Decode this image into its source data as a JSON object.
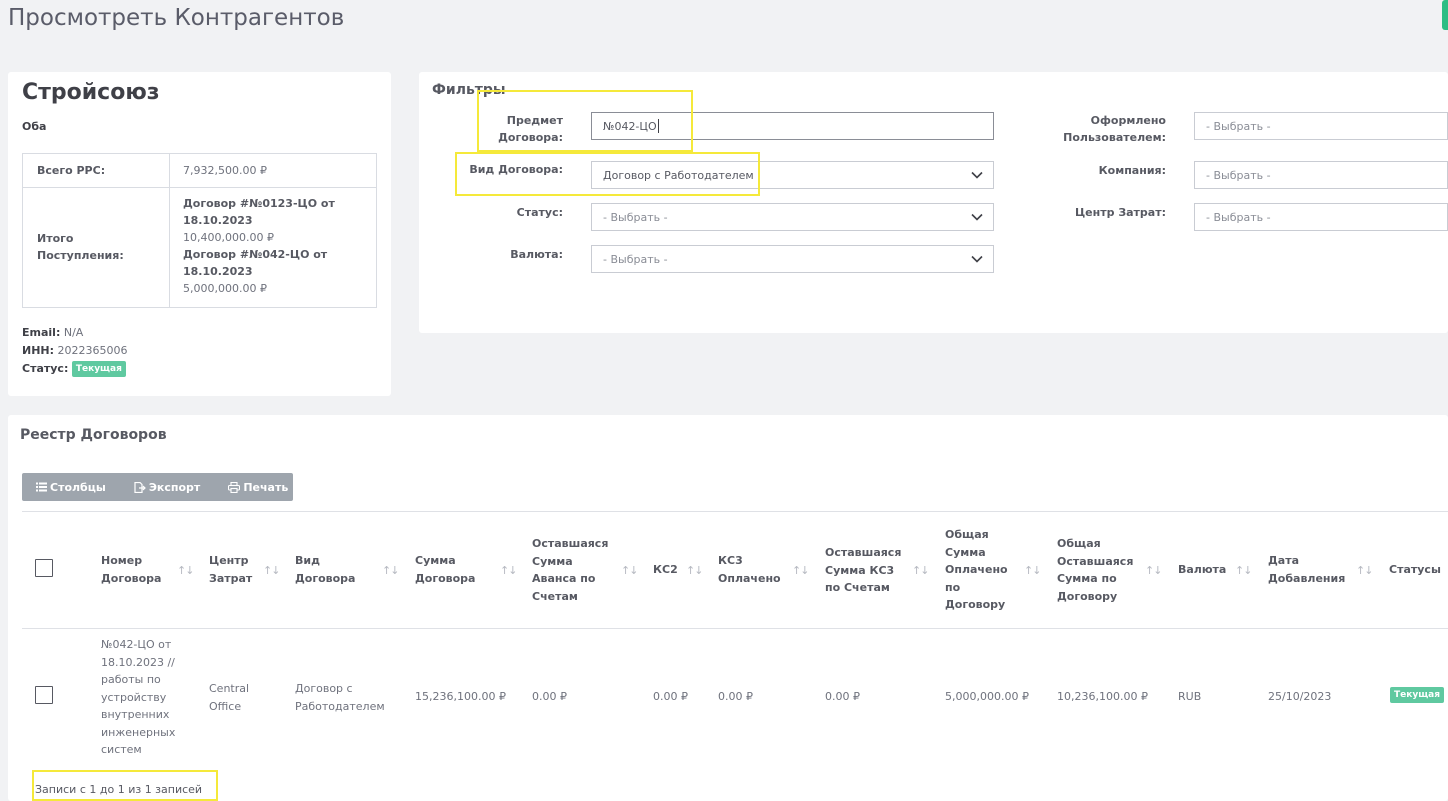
{
  "page": {
    "title": "Просмотреть Контрагентов"
  },
  "company": {
    "name": "Стройсоюз",
    "subtitle": "Оба",
    "total_rps_label": "Всего РРС:",
    "total_rps_value": "7,932,500.00 ₽",
    "receipts_label": "Итого Поступления:",
    "receipts": [
      {
        "contract": "Договор #№0123-ЦО от 18.10.2023",
        "amount": "10,400,000.00 ₽"
      },
      {
        "contract": "Договор #№042-ЦО от 18.10.2023",
        "amount": "5,000,000.00 ₽"
      }
    ],
    "email_label": "Email:",
    "email_value": "N/A",
    "inn_label": "ИНН:",
    "inn_value": "2022365006",
    "status_label": "Статус:",
    "status_value": "Текущая"
  },
  "filters": {
    "title": "Фильтры",
    "subject_label": "Предмет Договора:",
    "subject_value": "№042-ЦО",
    "type_label": "Вид Договора:",
    "type_value": "Договор с Работодателем",
    "status_label": "Статус:",
    "status_value": "- Выбрать -",
    "currency_label": "Валюта:",
    "currency_value": "- Выбрать -",
    "user_label": "Оформлено Пользователем:",
    "user_value": "- Выбрать -",
    "company_label": "Компания:",
    "company_value": "- Выбрать -",
    "cost_center_label": "Центр Затрат:",
    "cost_center_value": "- Выбрать -"
  },
  "registry": {
    "title": "Реестр Договоров",
    "buttons": {
      "columns": "Столбцы",
      "export": "Экспорт",
      "print": "Печать"
    },
    "columns": {
      "number": "Номер Договора",
      "cost_center": "Центр Затрат",
      "type": "Вид Договора",
      "amount": "Сумма Договора",
      "advance_remaining": "Оставшаяся Сумма Аванса по Счетам",
      "ks2": "КС2",
      "ks3_paid": "КС3 Оплачено",
      "ks3_remaining": "Оставшаяся Сумма КС3 по Счетам",
      "total_paid": "Общая Сумма Оплачено по Договору",
      "total_remaining": "Общая Оставшаяся Сумма по Договору",
      "currency": "Валюта",
      "date_added": "Дата Добавления",
      "statuses": "Статусы"
    },
    "rows": [
      {
        "number": "№042-ЦО от 18.10.2023 // работы по устройству внутренних инженерных систем",
        "cost_center": "Central Office",
        "type": "Договор с Работодателем",
        "amount": "15,236,100.00 ₽",
        "advance_remaining": "0.00 ₽",
        "ks2": "0.00 ₽",
        "ks3_paid": "0.00 ₽",
        "ks3_remaining": "0.00 ₽",
        "total_paid": "5,000,000.00 ₽",
        "total_remaining": "10,236,100.00 ₽",
        "currency": "RUB",
        "date_added": "25/10/2023",
        "status": "Текущая"
      }
    ],
    "info": "Записи с 1 до 1 из 1 записей"
  },
  "icons": {
    "columns": "list-icon",
    "export": "file-export-icon",
    "print": "printer-icon",
    "dropdown": "chevron-down-icon",
    "sort": "sort-arrows-icon"
  },
  "colors": {
    "highlight": "#f5e93a",
    "badge": "#5fc9a0",
    "button_group": "#9ea5ad"
  }
}
